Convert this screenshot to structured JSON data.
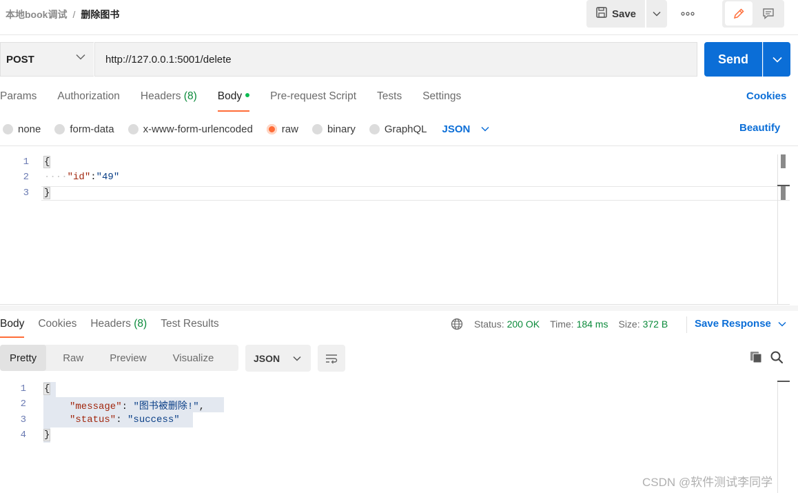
{
  "header": {
    "collection": "本地book调试",
    "separator": "/",
    "request_name": "删除图书",
    "save_label": "Save",
    "more_icon": "ellipsis-icon",
    "edit_icon": "pencil-icon",
    "comment_icon": "comment-icon"
  },
  "request": {
    "method": "POST",
    "url": "http://127.0.0.1:5001/delete",
    "send_label": "Send",
    "tabs": [
      {
        "label": "Params"
      },
      {
        "label": "Authorization"
      },
      {
        "label": "Headers",
        "count": "(8)"
      },
      {
        "label": "Body",
        "active": true
      },
      {
        "label": "Pre-request Script"
      },
      {
        "label": "Tests"
      },
      {
        "label": "Settings"
      }
    ],
    "cookies_label": "Cookies",
    "body_types": [
      "none",
      "form-data",
      "x-www-form-urlencoded",
      "raw",
      "binary",
      "GraphQL"
    ],
    "selected_body_type": "raw",
    "format": "JSON",
    "beautify_label": "Beautify",
    "editor_lines": [
      {
        "num": "1",
        "text": "{"
      },
      {
        "num": "2",
        "indent": "····",
        "key": "\"id\"",
        "colon": ":",
        "value": "\"49\""
      },
      {
        "num": "3",
        "text": "}"
      }
    ]
  },
  "response": {
    "tabs": [
      {
        "label": "Body",
        "active": true
      },
      {
        "label": "Cookies"
      },
      {
        "label": "Headers",
        "count": "(8)"
      },
      {
        "label": "Test Results"
      }
    ],
    "globe_icon": "globe-icon",
    "status_label": "Status:",
    "status_value": "200 OK",
    "time_label": "Time:",
    "time_value": "184 ms",
    "size_label": "Size:",
    "size_value": "372 B",
    "save_response_label": "Save Response",
    "view_tabs": [
      "Pretty",
      "Raw",
      "Preview",
      "Visualize"
    ],
    "active_view": "Pretty",
    "format": "JSON",
    "lines": [
      {
        "num": "1",
        "text": "{"
      },
      {
        "num": "2",
        "key": "\"message\"",
        "colon": ": ",
        "value": "\"图书被删除!\"",
        "trail": ","
      },
      {
        "num": "3",
        "key": "\"status\"",
        "colon": ": ",
        "value": "\"success\""
      },
      {
        "num": "4",
        "text": "}"
      }
    ]
  },
  "watermark": "CSDN @软件测试李同学",
  "colors": {
    "accent_orange": "#ff6c37",
    "primary_blue": "#0b6ed7",
    "status_green": "#0a8a3a"
  }
}
